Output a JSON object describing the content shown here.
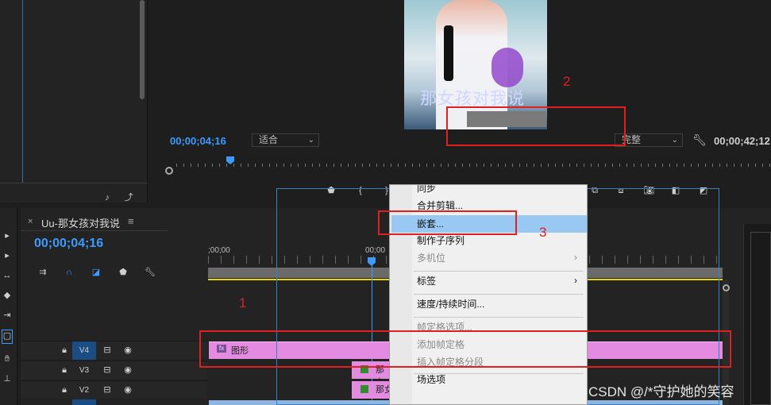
{
  "program_monitor": {
    "timecode": "00;00;04;16",
    "fit_select": "适合",
    "quality_select": "完整",
    "duration": "00;00;42;12",
    "subtitle_overlay": "那女孩对我说"
  },
  "timeline": {
    "sequence_name": "Uu-那女孩对我说",
    "menu_icon": "≡",
    "timecode": "00;00;04;16",
    "ruler_start": ";00;00",
    "ruler_mid": "00;00",
    "tracks": [
      {
        "name": "V4",
        "clip": "图形"
      },
      {
        "name": "V3",
        "clip": "那女"
      },
      {
        "name": "V2",
        "clip": "那女孩对我"
      }
    ]
  },
  "context_menu": {
    "items": [
      {
        "label": "同步",
        "disabled": false
      },
      {
        "label": "合并剪辑...",
        "disabled": false
      },
      {
        "label": "嵌套...",
        "disabled": false,
        "highlighted": true
      },
      {
        "label": "制作子序列",
        "disabled": false
      },
      {
        "label": "多机位",
        "disabled": true,
        "submenu": true
      },
      {
        "label": "标签",
        "disabled": false,
        "submenu": true
      },
      {
        "label": "速度/持续时间...",
        "disabled": false
      },
      {
        "label": "帧定格选项...",
        "disabled": true
      },
      {
        "label": "添加帧定格",
        "disabled": true
      },
      {
        "label": "插入帧定格分段",
        "disabled": true
      },
      {
        "label": "场选项",
        "disabled": false
      }
    ]
  },
  "annotations": {
    "one": "1",
    "two": "2",
    "three": "3"
  },
  "watermark": "CSDN @/*守护她的笑容",
  "colors": {
    "accent_blue": "#3d9bff",
    "clip_pink": "#e38be0",
    "annotation_red": "#e02020",
    "menu_highlight": "#99c9f2"
  }
}
